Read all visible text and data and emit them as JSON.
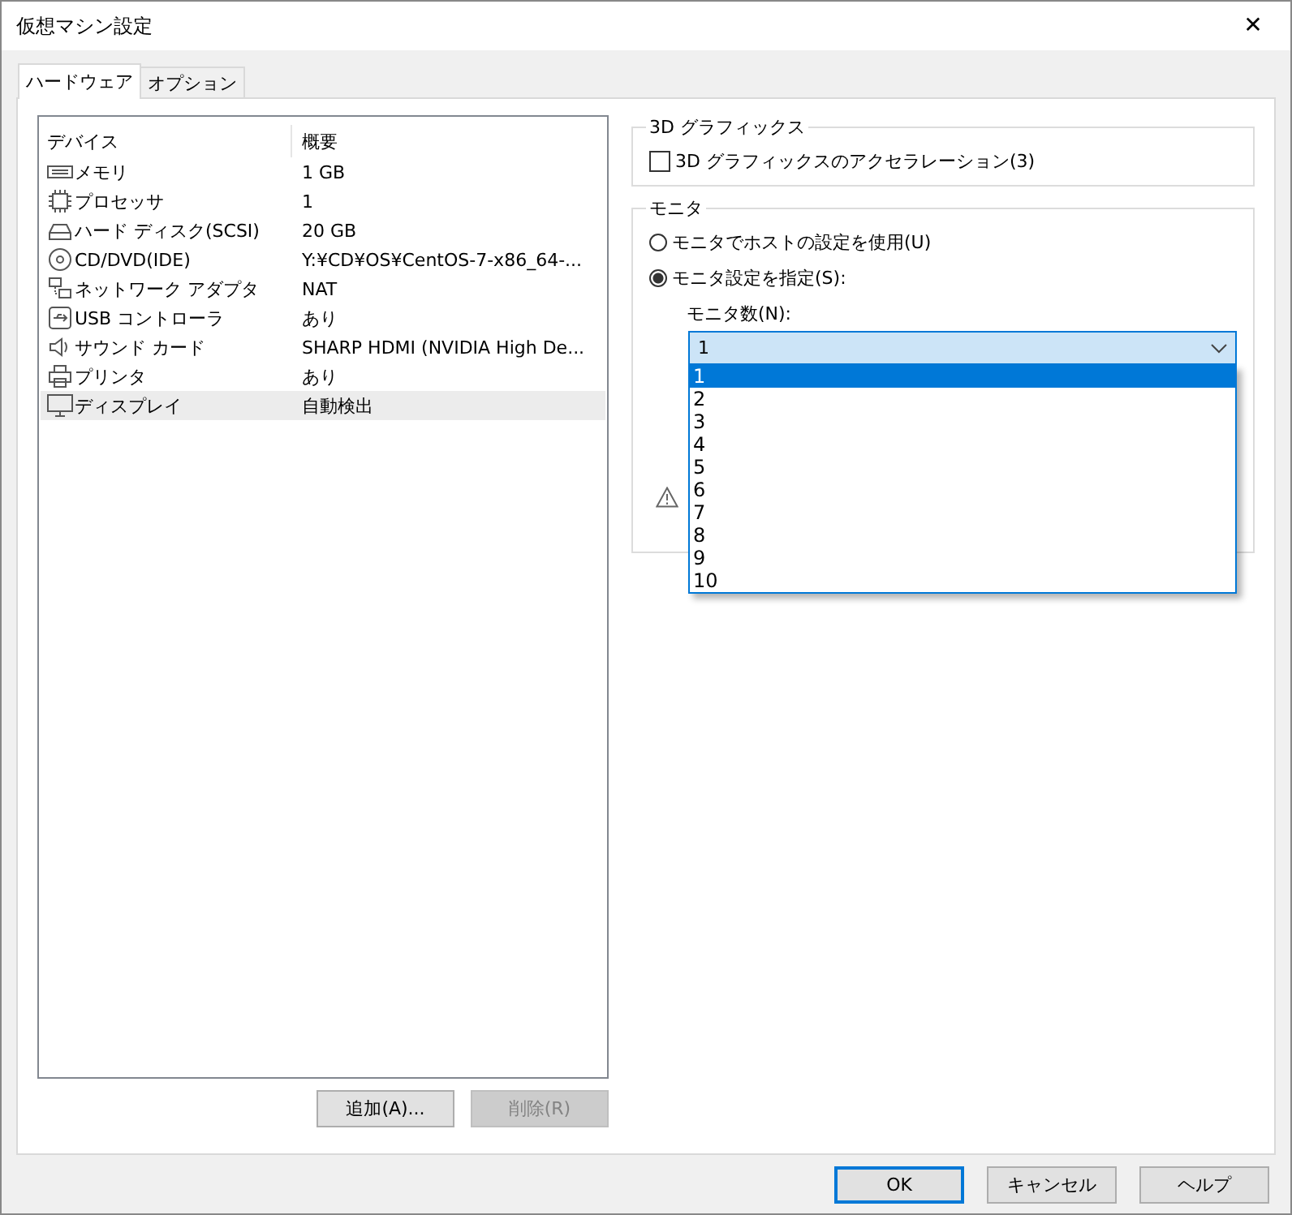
{
  "window": {
    "title": "仮想マシン設定",
    "close": "✕"
  },
  "tabs": [
    {
      "label": "ハードウェア",
      "selected": true
    },
    {
      "label": "オプション",
      "selected": false
    }
  ],
  "devices": {
    "columns": [
      "デバイス",
      "概要"
    ],
    "rows": [
      {
        "kind": "memory",
        "name": "メモリ",
        "summary": "1 GB",
        "selected": false
      },
      {
        "kind": "processor",
        "name": "プロセッサ",
        "summary": "1",
        "selected": false
      },
      {
        "kind": "disk",
        "name": "ハード ディスク(SCSI)",
        "summary": "20 GB",
        "selected": false
      },
      {
        "kind": "cd",
        "name": "CD/DVD(IDE)",
        "summary": "Y:¥CD¥OS¥CentOS-7-x86_64-...",
        "selected": false
      },
      {
        "kind": "network",
        "name": "ネットワーク アダプタ",
        "summary": "NAT",
        "selected": false
      },
      {
        "kind": "usb",
        "name": "USB コントローラ",
        "summary": "あり",
        "selected": false
      },
      {
        "kind": "sound",
        "name": "サウンド カード",
        "summary": "SHARP HDMI (NVIDIA High De...",
        "selected": false
      },
      {
        "kind": "printer",
        "name": "プリンタ",
        "summary": "あり",
        "selected": false
      },
      {
        "kind": "display",
        "name": "ディスプレイ",
        "summary": "自動検出",
        "selected": true
      }
    ],
    "buttons": [
      {
        "label": "追加(A)...",
        "disabled": false
      },
      {
        "label": "削除(R)",
        "disabled": true
      }
    ]
  },
  "graphics": {
    "title": "3D グラフィックス",
    "accel": {
      "label": "3D グラフィックスのアクセラレーション(3)",
      "checked": false
    }
  },
  "monitor": {
    "title": "モニタ",
    "options": [
      {
        "label": "モニタでホストの設定を使用(U)",
        "selected": false
      },
      {
        "label": "モニタ設定を指定(S):",
        "selected": true
      }
    ],
    "count_label": "モニタ数(N):",
    "count": {
      "value": "1",
      "expanded": true,
      "options": [
        {
          "label": "1",
          "selected": true
        },
        {
          "label": "2",
          "selected": false
        },
        {
          "label": "3",
          "selected": false
        },
        {
          "label": "4",
          "selected": false
        },
        {
          "label": "5",
          "selected": false
        },
        {
          "label": "6",
          "selected": false
        },
        {
          "label": "7",
          "selected": false
        },
        {
          "label": "8",
          "selected": false
        },
        {
          "label": "9",
          "selected": false
        },
        {
          "label": "10",
          "selected": false
        }
      ]
    },
    "warning": true
  },
  "footer": [
    {
      "label": "OK",
      "default": true
    },
    {
      "label": "キャンセル",
      "default": false
    },
    {
      "label": "ヘルプ",
      "default": false
    }
  ]
}
